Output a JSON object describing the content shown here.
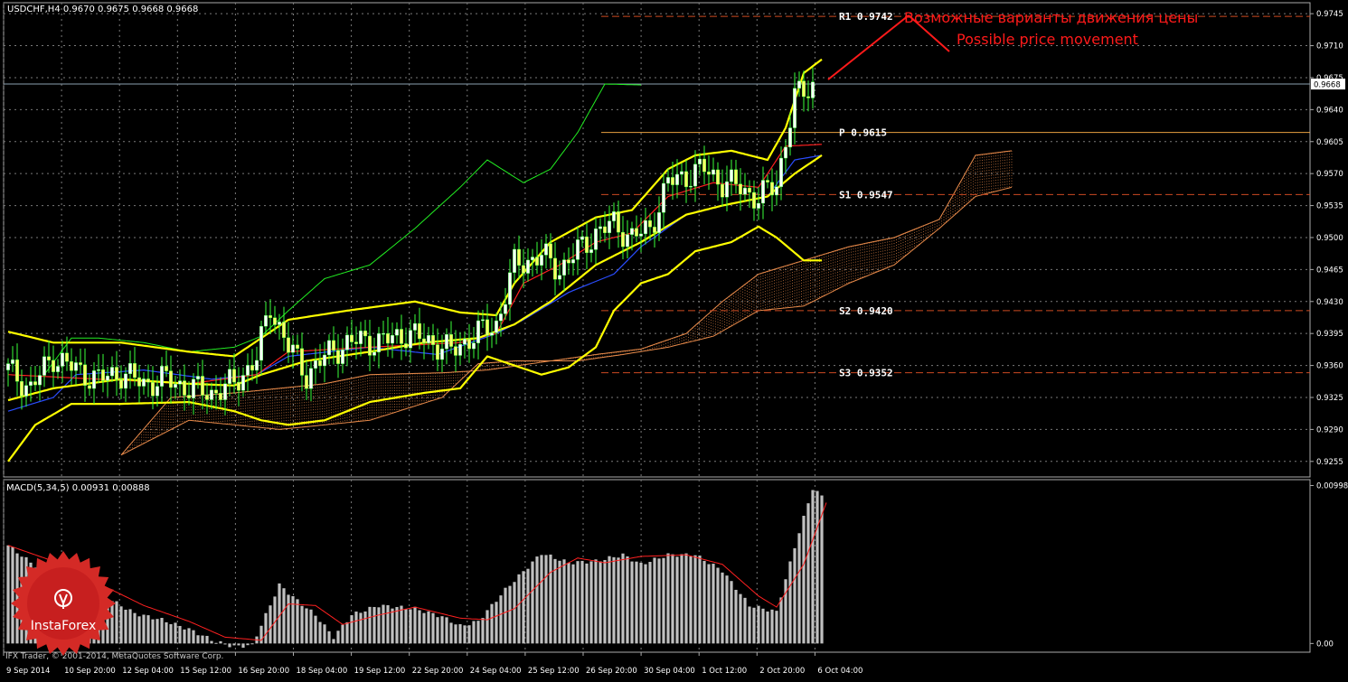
{
  "header": {
    "symbol_line": "USDCHF,H4  0.9670 0.9675 0.9668 0.9668",
    "macd_label": "MACD(5,34,5) 0.00931 0.00888",
    "copyright": "IFX Trader, © 2001-2014, MetaQuotes Software Corp."
  },
  "annotation": {
    "line1": "Возможные варианты движения цены",
    "line2": "Possible price movement"
  },
  "logo": {
    "text": "InstaForex"
  },
  "colors": {
    "background": "#000000",
    "grid": "#7a7a7a",
    "bull_candle": "#ffffff",
    "bear_candle": "#ffff66",
    "wick_bull": "#3aff3a",
    "wick_bear": "#3aff3a",
    "bollinger": "#ffff00",
    "chikou": "#22ee22",
    "tenkan": "#ff2020",
    "kijun": "#2a4dff",
    "cloud": "#e88a4a",
    "pivot_levels": "#cc4a22",
    "pivot_p": "#e8a040",
    "current_price_line": "#8aa0b0",
    "macd_hist": "#c0c0c0",
    "macd_signal": "#ff2020",
    "annotation": "#ff1a1a",
    "text": "#ffffff"
  },
  "chart_data": [
    {
      "type": "candlestick",
      "title": "USDCHF,H4",
      "ylim": [
        0.9238,
        0.9757
      ],
      "y_ticks": [
        "0.9745",
        "0.9710",
        "0.9675",
        "0.9640",
        "0.9605",
        "0.9570",
        "0.9535",
        "0.9500",
        "0.9465",
        "0.9430",
        "0.9395",
        "0.9360",
        "0.9325",
        "0.9290",
        "0.9255"
      ],
      "x_ticks": [
        "9 Sep 2014",
        "10 Sep 20:00",
        "12 Sep 04:00",
        "15 Sep 12:00",
        "16 Sep 20:00",
        "18 Sep 04:00",
        "19 Sep 12:00",
        "22 Sep 20:00",
        "24 Sep 04:00",
        "25 Sep 12:00",
        "26 Sep 20:00",
        "30 Sep 04:00",
        "1 Oct 12:00",
        "2 Oct 20:00",
        "6 Oct 04:00"
      ],
      "current_price": "0.9668",
      "pivot_levels": [
        {
          "name": "R1",
          "label": "R1  0.9742",
          "value": 0.9742
        },
        {
          "name": "P",
          "label": "P  0.9615",
          "value": 0.9615
        },
        {
          "name": "S1",
          "label": "S1  0.9547",
          "value": 0.9547
        },
        {
          "name": "S2",
          "label": "S2  0.9420",
          "value": 0.942
        },
        {
          "name": "S3",
          "label": "S3  0.9352",
          "value": 0.9352
        }
      ],
      "close_anchors": [
        [
          0,
          0.9355
        ],
        [
          5,
          0.9335
        ],
        [
          10,
          0.937
        ],
        [
          15,
          0.9355
        ],
        [
          20,
          0.9345
        ],
        [
          25,
          0.9352
        ],
        [
          30,
          0.934
        ],
        [
          35,
          0.9345
        ],
        [
          40,
          0.9335
        ],
        [
          45,
          0.933
        ],
        [
          50,
          0.934
        ],
        [
          55,
          0.9368
        ],
        [
          58,
          0.9425
        ],
        [
          62,
          0.938
        ],
        [
          66,
          0.935
        ],
        [
          72,
          0.9378
        ],
        [
          78,
          0.9388
        ],
        [
          82,
          0.9385
        ],
        [
          88,
          0.9395
        ],
        [
          94,
          0.9385
        ],
        [
          98,
          0.9375
        ],
        [
          102,
          0.939
        ],
        [
          108,
          0.9405
        ],
        [
          112,
          0.947
        ],
        [
          118,
          0.948
        ],
        [
          122,
          0.9465
        ],
        [
          126,
          0.9485
        ],
        [
          130,
          0.9505
        ],
        [
          134,
          0.9515
        ],
        [
          138,
          0.95
        ],
        [
          142,
          0.951
        ],
        [
          146,
          0.956
        ],
        [
          150,
          0.9568
        ],
        [
          154,
          0.9575
        ],
        [
          158,
          0.956
        ],
        [
          162,
          0.9555
        ],
        [
          166,
          0.9542
        ],
        [
          170,
          0.956
        ],
        [
          174,
          0.9652
        ],
        [
          178,
          0.9668
        ]
      ],
      "bollinger_upper": [
        [
          0,
          0.9397
        ],
        [
          10,
          0.9385
        ],
        [
          25,
          0.9385
        ],
        [
          40,
          0.9375
        ],
        [
          50,
          0.937
        ],
        [
          56,
          0.939
        ],
        [
          62,
          0.941
        ],
        [
          75,
          0.942
        ],
        [
          90,
          0.943
        ],
        [
          100,
          0.9418
        ],
        [
          108,
          0.9415
        ],
        [
          112,
          0.945
        ],
        [
          120,
          0.9495
        ],
        [
          130,
          0.9522
        ],
        [
          138,
          0.953
        ],
        [
          146,
          0.9575
        ],
        [
          152,
          0.959
        ],
        [
          160,
          0.9595
        ],
        [
          168,
          0.9585
        ],
        [
          172,
          0.962
        ],
        [
          176,
          0.968
        ],
        [
          180,
          0.9695
        ]
      ],
      "bollinger_middle": [
        [
          0,
          0.9322
        ],
        [
          10,
          0.9335
        ],
        [
          25,
          0.9345
        ],
        [
          40,
          0.934
        ],
        [
          50,
          0.9338
        ],
        [
          56,
          0.935
        ],
        [
          66,
          0.9365
        ],
        [
          80,
          0.9375
        ],
        [
          92,
          0.9385
        ],
        [
          104,
          0.939
        ],
        [
          112,
          0.9405
        ],
        [
          120,
          0.943
        ],
        [
          130,
          0.947
        ],
        [
          140,
          0.9495
        ],
        [
          150,
          0.9525
        ],
        [
          158,
          0.9535
        ],
        [
          168,
          0.9545
        ],
        [
          174,
          0.957
        ],
        [
          180,
          0.959
        ]
      ],
      "bollinger_lower": [
        [
          0,
          0.9255
        ],
        [
          6,
          0.9295
        ],
        [
          14,
          0.9318
        ],
        [
          25,
          0.9318
        ],
        [
          40,
          0.932
        ],
        [
          50,
          0.931
        ],
        [
          56,
          0.93
        ],
        [
          62,
          0.9295
        ],
        [
          70,
          0.93
        ],
        [
          80,
          0.932
        ],
        [
          92,
          0.933
        ],
        [
          100,
          0.9335
        ],
        [
          106,
          0.937
        ],
        [
          112,
          0.936
        ],
        [
          118,
          0.935
        ],
        [
          124,
          0.9358
        ],
        [
          130,
          0.938
        ],
        [
          134,
          0.942
        ],
        [
          140,
          0.945
        ],
        [
          146,
          0.946
        ],
        [
          152,
          0.9485
        ],
        [
          160,
          0.9495
        ],
        [
          166,
          0.9512
        ],
        [
          170,
          0.95
        ],
        [
          176,
          0.9475
        ],
        [
          180,
          0.9475
        ]
      ],
      "tenkan": [
        [
          0,
          0.935
        ],
        [
          20,
          0.9345
        ],
        [
          40,
          0.934
        ],
        [
          55,
          0.935
        ],
        [
          62,
          0.9375
        ],
        [
          80,
          0.938
        ],
        [
          100,
          0.9385
        ],
        [
          108,
          0.9395
        ],
        [
          114,
          0.945
        ],
        [
          122,
          0.947
        ],
        [
          130,
          0.9495
        ],
        [
          138,
          0.9505
        ],
        [
          146,
          0.9545
        ],
        [
          156,
          0.956
        ],
        [
          166,
          0.9555
        ],
        [
          172,
          0.96
        ],
        [
          180,
          0.9602
        ]
      ],
      "kijun": [
        [
          0,
          0.931
        ],
        [
          10,
          0.9325
        ],
        [
          15,
          0.935
        ],
        [
          30,
          0.9355
        ],
        [
          45,
          0.9345
        ],
        [
          55,
          0.935
        ],
        [
          62,
          0.937
        ],
        [
          80,
          0.938
        ],
        [
          95,
          0.9372
        ],
        [
          108,
          0.9395
        ],
        [
          114,
          0.941
        ],
        [
          124,
          0.944
        ],
        [
          134,
          0.946
        ],
        [
          140,
          0.949
        ],
        [
          150,
          0.9525
        ],
        [
          158,
          0.9535
        ],
        [
          168,
          0.9545
        ],
        [
          174,
          0.9585
        ],
        [
          180,
          0.959
        ]
      ],
      "chikou": [
        [
          8,
          0.935
        ],
        [
          14,
          0.939
        ],
        [
          20,
          0.939
        ],
        [
          30,
          0.9385
        ],
        [
          40,
          0.9375
        ],
        [
          50,
          0.938
        ],
        [
          56,
          0.9392
        ],
        [
          62,
          0.942
        ],
        [
          70,
          0.9455
        ],
        [
          80,
          0.947
        ],
        [
          90,
          0.951
        ],
        [
          100,
          0.9555
        ],
        [
          106,
          0.9585
        ],
        [
          114,
          0.956
        ],
        [
          120,
          0.9575
        ],
        [
          126,
          0.9615
        ],
        [
          132,
          0.9668
        ],
        [
          140,
          0.9667
        ]
      ],
      "cloud_upper": [
        [
          25,
          0.9262
        ],
        [
          36,
          0.9325
        ],
        [
          50,
          0.933
        ],
        [
          60,
          0.9335
        ],
        [
          70,
          0.934
        ],
        [
          80,
          0.935
        ],
        [
          96,
          0.9352
        ],
        [
          106,
          0.9355
        ],
        [
          120,
          0.9365
        ],
        [
          130,
          0.9372
        ],
        [
          140,
          0.9378
        ],
        [
          150,
          0.9395
        ],
        [
          158,
          0.943
        ],
        [
          166,
          0.946
        ],
        [
          176,
          0.9475
        ],
        [
          186,
          0.949
        ],
        [
          196,
          0.95
        ],
        [
          206,
          0.952
        ],
        [
          214,
          0.959
        ],
        [
          222,
          0.9595
        ]
      ],
      "cloud_lower": [
        [
          25,
          0.9262
        ],
        [
          40,
          0.93
        ],
        [
          60,
          0.929
        ],
        [
          80,
          0.93
        ],
        [
          96,
          0.9325
        ],
        [
          104,
          0.9362
        ],
        [
          112,
          0.9365
        ],
        [
          126,
          0.9365
        ],
        [
          136,
          0.9372
        ],
        [
          146,
          0.938
        ],
        [
          156,
          0.9392
        ],
        [
          166,
          0.942
        ],
        [
          176,
          0.9425
        ],
        [
          186,
          0.945
        ],
        [
          196,
          0.947
        ],
        [
          206,
          0.951
        ],
        [
          214,
          0.9545
        ],
        [
          222,
          0.9555
        ]
      ]
    },
    {
      "type": "bar",
      "title": "MACD(5,34,5) 0.00931 0.00888",
      "ylim": [
        -0.00055,
        0.01035
      ],
      "y_ticks": [
        "0.00998",
        "0.00"
      ],
      "hist_anchors": [
        [
          0,
          0.0062
        ],
        [
          6,
          0.0049
        ],
        [
          12,
          0.0038
        ],
        [
          20,
          0.0032
        ],
        [
          28,
          0.0019
        ],
        [
          34,
          0.0015
        ],
        [
          40,
          0.0009
        ],
        [
          46,
          0.0001
        ],
        [
          50,
          -0.0002
        ],
        [
          54,
          -0.0001
        ],
        [
          60,
          0.0037
        ],
        [
          64,
          0.0027
        ],
        [
          68,
          0.0018
        ],
        [
          72,
          0.0004
        ],
        [
          76,
          0.0018
        ],
        [
          82,
          0.0024
        ],
        [
          90,
          0.0022
        ],
        [
          96,
          0.0017
        ],
        [
          100,
          0.0011
        ],
        [
          104,
          0.0014
        ],
        [
          110,
          0.0034
        ],
        [
          118,
          0.0057
        ],
        [
          124,
          0.0051
        ],
        [
          130,
          0.0052
        ],
        [
          136,
          0.0056
        ],
        [
          140,
          0.005
        ],
        [
          146,
          0.0056
        ],
        [
          152,
          0.0056
        ],
        [
          158,
          0.0046
        ],
        [
          164,
          0.0024
        ],
        [
          170,
          0.002
        ],
        [
          174,
          0.0061
        ],
        [
          178,
          0.0098
        ],
        [
          180,
          0.0093
        ]
      ],
      "signal_anchors": [
        [
          0,
          0.0062
        ],
        [
          10,
          0.0052
        ],
        [
          20,
          0.0038
        ],
        [
          30,
          0.0024
        ],
        [
          40,
          0.0014
        ],
        [
          48,
          0.0004
        ],
        [
          56,
          0.0002
        ],
        [
          62,
          0.0025
        ],
        [
          68,
          0.0024
        ],
        [
          74,
          0.0012
        ],
        [
          82,
          0.0018
        ],
        [
          90,
          0.0023
        ],
        [
          100,
          0.0016
        ],
        [
          106,
          0.0015
        ],
        [
          112,
          0.0022
        ],
        [
          120,
          0.0045
        ],
        [
          126,
          0.0054
        ],
        [
          132,
          0.0051
        ],
        [
          140,
          0.0055
        ],
        [
          150,
          0.0056
        ],
        [
          158,
          0.005
        ],
        [
          166,
          0.003
        ],
        [
          170,
          0.0023
        ],
        [
          176,
          0.005
        ],
        [
          181,
          0.0089
        ]
      ]
    }
  ]
}
